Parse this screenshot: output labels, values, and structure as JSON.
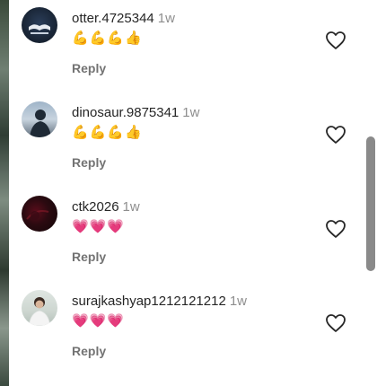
{
  "comments": [
    {
      "username": "otter.4725344",
      "time": "1w",
      "reactions": "💪💪💪👍",
      "reply": "Reply"
    },
    {
      "username": "dinosaur.9875341",
      "time": "1w",
      "reactions": "💪💪💪👍",
      "reply": "Reply"
    },
    {
      "username": "ctk2026",
      "time": "1w",
      "reactions": "💗💗💗",
      "reply": "Reply"
    },
    {
      "username": "surajkashyap1212121212",
      "time": "1w",
      "reactions": "💗💗💗",
      "reply": "Reply"
    }
  ],
  "icons": {
    "like": "heart-outline-icon"
  },
  "colors": {
    "text": "#262626",
    "secondary": "#8e8e8e",
    "scrollbar": "#8a8a8a"
  }
}
